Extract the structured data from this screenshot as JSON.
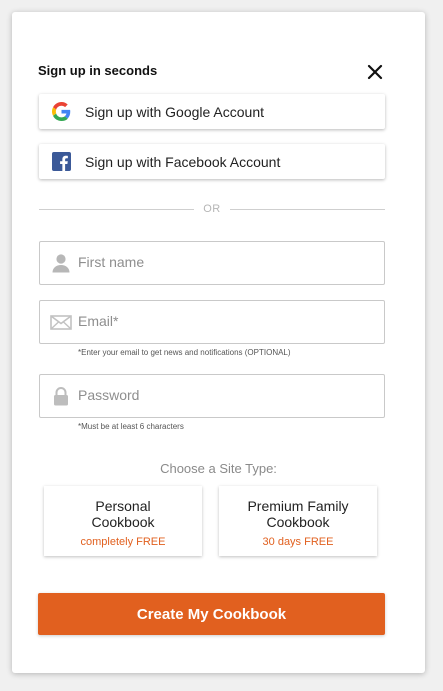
{
  "modal": {
    "title": "Sign up in seconds",
    "close_icon": "close-icon"
  },
  "social": {
    "google_label": "Sign up with Google Account",
    "google_icon": "google-icon",
    "facebook_label": "Sign up with Facebook Account",
    "facebook_icon": "facebook-icon"
  },
  "divider": {
    "text": "OR"
  },
  "form": {
    "first_name": {
      "placeholder": "First name",
      "value": "",
      "icon": "user-icon"
    },
    "email": {
      "placeholder": "Email*",
      "value": "",
      "icon": "envelope-icon",
      "hint": "*Enter your email to get news and notifications (OPTIONAL)"
    },
    "password": {
      "placeholder": "Password",
      "value": "",
      "icon": "lock-icon",
      "hint": "*Must be at least 6 characters"
    }
  },
  "site_type": {
    "label": "Choose a Site Type:",
    "options": [
      {
        "name": "Personal\nCookbook",
        "price": "completely FREE"
      },
      {
        "name": "Premium Family\nCookbook",
        "price": "30 days FREE"
      }
    ]
  },
  "cta": {
    "label": "Create My Cookbook"
  },
  "colors": {
    "accent": "#e1601f",
    "facebook": "#3b5998",
    "border": "#c9c9c9",
    "background": "#f0f0f0"
  }
}
